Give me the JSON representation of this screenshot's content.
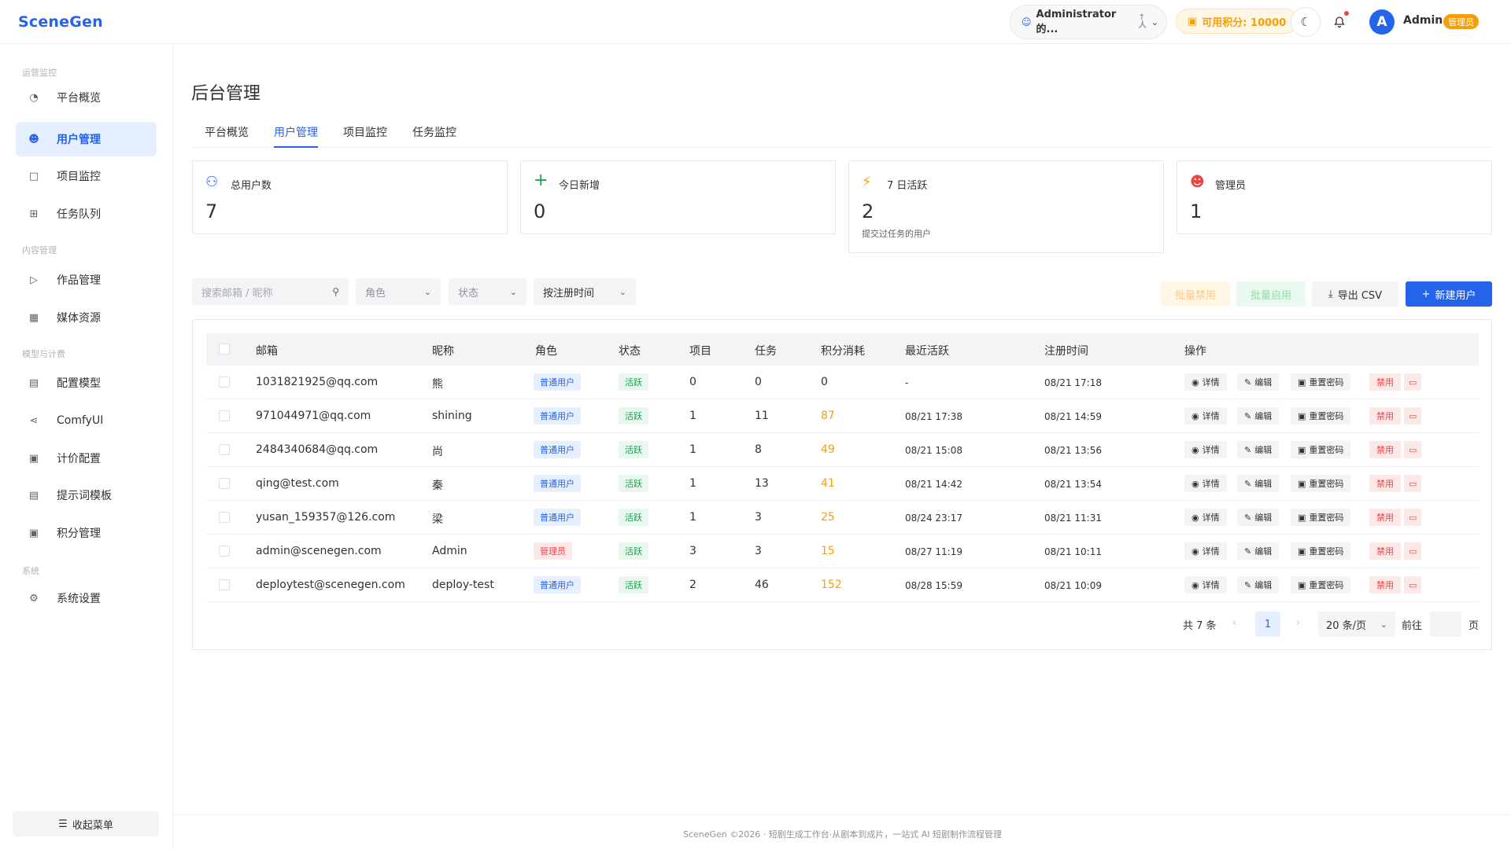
{
  "header": {
    "logo": "SceneGen",
    "project_selector": "Administrator 的...",
    "sort_up": "↑",
    "sort_down": "人",
    "points": "可用积分: 10000",
    "user_avatar_letter": "A",
    "user_name": "Admin",
    "user_badge": "管理员"
  },
  "sidebar": {
    "groups": [
      "运营监控",
      "内容管理",
      "模型与计费",
      "系统"
    ],
    "items": [
      {
        "label": "平台概览",
        "icon": "dashboard-icon"
      },
      {
        "label": "用户管理",
        "icon": "user-icon"
      },
      {
        "label": "项目监控",
        "icon": "folder-icon"
      },
      {
        "label": "任务队列",
        "icon": "grid-icon"
      },
      {
        "label": "作品管理",
        "icon": "video-icon"
      },
      {
        "label": "媒体资源",
        "icon": "image-icon"
      },
      {
        "label": "配置模型",
        "icon": "list-icon"
      },
      {
        "label": "ComfyUI",
        "icon": "flow-icon"
      },
      {
        "label": "计价配置",
        "icon": "pricing-icon"
      },
      {
        "label": "提示词模板",
        "icon": "document-icon"
      },
      {
        "label": "积分管理",
        "icon": "points-icon"
      },
      {
        "label": "系统设置",
        "icon": "settings-icon"
      }
    ],
    "collapse_label": "收起菜单"
  },
  "main": {
    "title": "后台管理",
    "tabs": [
      "平台概览",
      "用户管理",
      "项目监控",
      "任务监控"
    ],
    "active_tab": "用户管理",
    "stats": [
      {
        "label": "总用户数",
        "value": "7",
        "sub": "",
        "color": "#2563eb"
      },
      {
        "label": "今日新增",
        "value": "0",
        "sub": "",
        "color": "#16a34a"
      },
      {
        "label": "7 日活跃",
        "value": "2",
        "sub": "提交过任务的用户",
        "color": "#f59e0b"
      },
      {
        "label": "管理员",
        "value": "1",
        "sub": "",
        "color": "#ef4444"
      }
    ],
    "filters": {
      "search_placeholder": "搜索邮箱 / 昵称",
      "role_placeholder": "角色",
      "status_placeholder": "状态",
      "sort_value": "按注册时间"
    },
    "buttons": {
      "batch_disable": "批量禁用",
      "batch_enable": "批量启用",
      "export": "导出 CSV",
      "new_user": "新建用户"
    },
    "table": {
      "columns": [
        "邮箱",
        "昵称",
        "角色",
        "状态",
        "项目",
        "任务",
        "积分消耗",
        "最近活跃",
        "注册时间",
        "操作"
      ],
      "rows": [
        {
          "email": "1031821925@qq.com",
          "nickname": "熊",
          "role": "普通用户",
          "role_type": "user",
          "status": "活跃",
          "projects": "0",
          "tasks": "0",
          "points": "0",
          "points_hl": false,
          "last_active": "-",
          "registered": "08/21 17:18"
        },
        {
          "email": "971044971@qq.com",
          "nickname": "shining",
          "role": "普通用户",
          "role_type": "user",
          "status": "活跃",
          "projects": "1",
          "tasks": "11",
          "points": "87",
          "points_hl": true,
          "last_active": "08/21 17:38",
          "registered": "08/21 14:59"
        },
        {
          "email": "2484340684@qq.com",
          "nickname": "尚",
          "role": "普通用户",
          "role_type": "user",
          "status": "活跃",
          "projects": "1",
          "tasks": "8",
          "points": "49",
          "points_hl": true,
          "last_active": "08/21 15:08",
          "registered": "08/21 13:56"
        },
        {
          "email": "qing@test.com",
          "nickname": "秦",
          "role": "普通用户",
          "role_type": "user",
          "status": "活跃",
          "projects": "1",
          "tasks": "13",
          "points": "41",
          "points_hl": true,
          "last_active": "08/21 14:42",
          "registered": "08/21 13:54"
        },
        {
          "email": "yusan_159357@126.com",
          "nickname": "梁",
          "role": "普通用户",
          "role_type": "user",
          "status": "活跃",
          "projects": "1",
          "tasks": "3",
          "points": "25",
          "points_hl": true,
          "last_active": "08/24 23:17",
          "registered": "08/21 11:31"
        },
        {
          "email": "admin@scenegen.com",
          "nickname": "Admin",
          "role": "管理员",
          "role_type": "admin",
          "status": "活跃",
          "projects": "3",
          "tasks": "3",
          "points": "15",
          "points_hl": true,
          "last_active": "08/27 11:19",
          "registered": "08/21 10:11"
        },
        {
          "email": "deploytest@scenegen.com",
          "nickname": "deploy-test",
          "role": "普通用户",
          "role_type": "user",
          "status": "活跃",
          "projects": "2",
          "tasks": "46",
          "points": "152",
          "points_hl": true,
          "last_active": "08/28 15:59",
          "registered": "08/21 10:09"
        }
      ],
      "actions": {
        "detail": "详情",
        "edit": "编辑",
        "reset": "重置密码",
        "ban": "禁用"
      }
    },
    "pagination": {
      "total": "共 7 条",
      "prev": "‹",
      "current": "1",
      "next": "›",
      "page_size": "20 条/页",
      "goto_label": "前往",
      "page_label": "页"
    }
  },
  "footer": {
    "text": "SceneGen ©2026 · 短剧生成工作台·从剧本到成片，一站式 AI 短剧制作流程管理"
  }
}
